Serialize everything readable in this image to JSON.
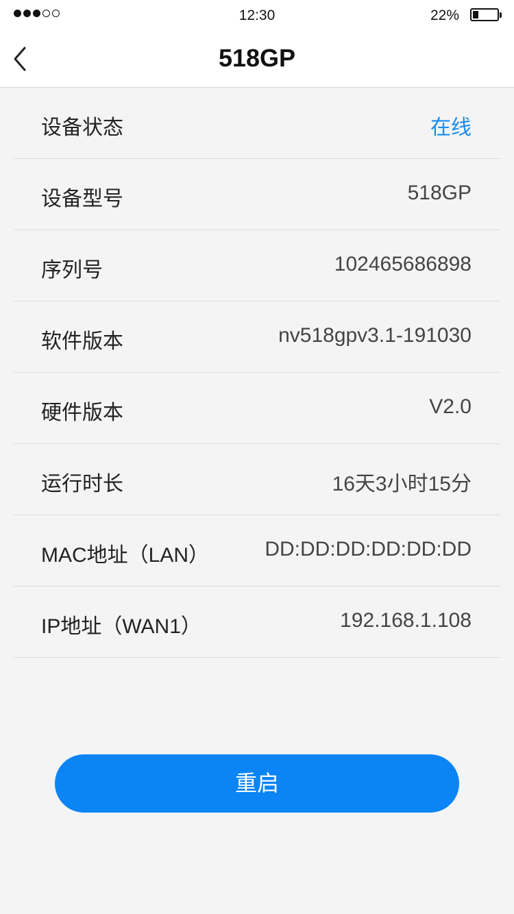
{
  "status_bar": {
    "signal_dots": [
      true,
      true,
      true,
      false,
      false
    ],
    "time": "12:30",
    "battery_percent": "22%",
    "battery_level": 0.22
  },
  "nav": {
    "back_icon": "chevron-left-icon",
    "title": "518GP"
  },
  "device_info": [
    {
      "label": "设备状态",
      "value": "在线",
      "key": "status"
    },
    {
      "label": "设备型号",
      "value": "518GP",
      "key": "model"
    },
    {
      "label": "序列号",
      "value": "102465686898",
      "key": "serial"
    },
    {
      "label": "软件版本",
      "value": "nv518gpv3.1-191030",
      "key": "software-version"
    },
    {
      "label": "硬件版本",
      "value": "V2.0",
      "key": "hardware-version"
    },
    {
      "label": "运行时长",
      "value": "16天3小时15分",
      "key": "uptime"
    },
    {
      "label": "MAC地址（LAN）",
      "value": "DD:DD:DD:DD:DD:DD",
      "key": "mac-lan"
    },
    {
      "label": "IP地址（WAN1）",
      "value": "192.168.1.108",
      "key": "ip-wan1"
    }
  ],
  "actions": {
    "restart_label": "重启"
  },
  "colors": {
    "accent": "#0b84f6",
    "online": "#1a8cf0",
    "background": "#f4f4f4"
  }
}
